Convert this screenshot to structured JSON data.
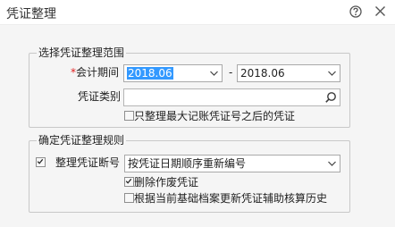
{
  "window": {
    "title": "凭证整理"
  },
  "range_group": {
    "title": "选择凭证整理范围",
    "period_label": "会计期间",
    "required_mark": "*",
    "period_from": "2018.06",
    "period_separator": "-",
    "period_to": "2018.06",
    "category_label": "凭证类别",
    "category_value": "",
    "only_after_max_label": "只整理最大记账凭证号之后的凭证",
    "only_after_max_checked": false
  },
  "rule_group": {
    "title": "确定凭证整理规则",
    "break_label": "整理凭证断号",
    "break_checked": true,
    "break_option": "按凭证日期顺序重新编号",
    "delete_void_label": "删除作废凭证",
    "delete_void_checked": true,
    "update_aux_label": "根据当前基础档案更新凭证辅助核算历史",
    "update_aux_checked": false
  }
}
